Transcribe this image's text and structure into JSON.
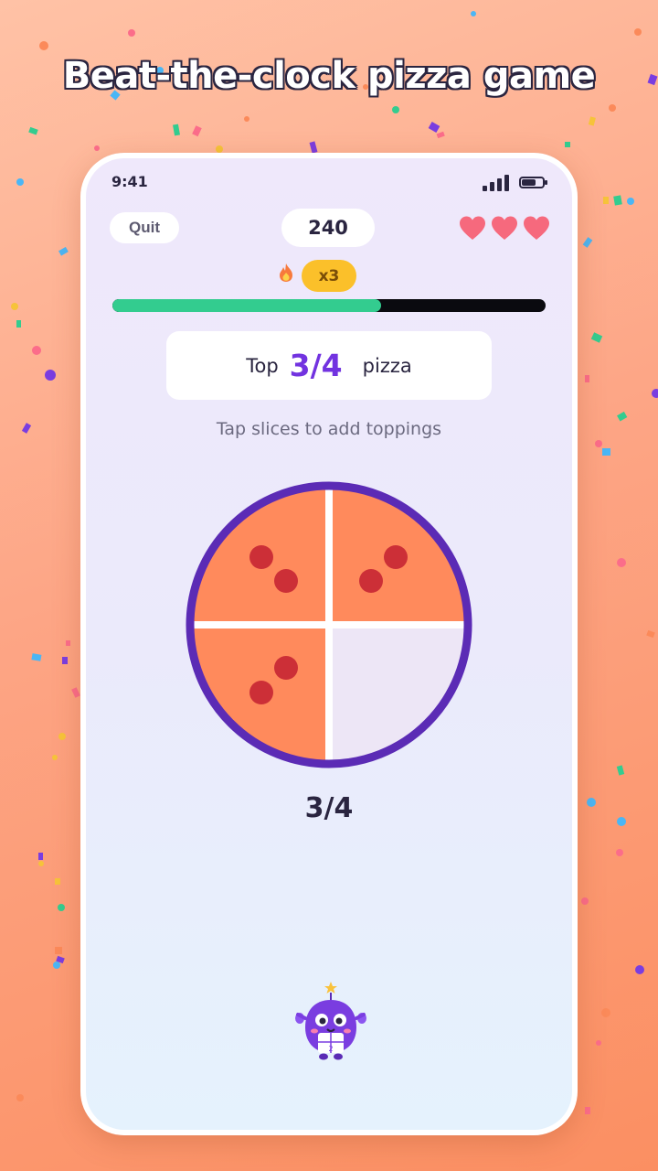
{
  "promo": {
    "title": "Beat-the-clock pizza game"
  },
  "status_bar": {
    "time": "9:41"
  },
  "header": {
    "quit_label": "Quit",
    "score": "240",
    "lives": 3,
    "streak_multiplier": "x3",
    "time_remaining_fraction": 0.62
  },
  "prompt": {
    "prefix": "Top",
    "fraction": "3/4",
    "suffix": "pizza"
  },
  "instruction": "Tap slices to add toppings",
  "pizza": {
    "slices": 4,
    "topped_slices": [
      "top-left",
      "top-right",
      "bottom-left"
    ]
  },
  "answer_label": "3/4",
  "icons": {
    "flame": "flame-icon",
    "heart": "heart-icon",
    "mascot": "mascot-character"
  },
  "colors": {
    "accent": "#7233e0",
    "crust": "#5b2bb5",
    "sauce": "#ff8a5c",
    "pepperoni": "#cc2f37",
    "empty_slice": "#ede6f6",
    "progress": "#33cc8f",
    "heart": "#f6697d",
    "multiplier_badge": "#fbc02a"
  }
}
